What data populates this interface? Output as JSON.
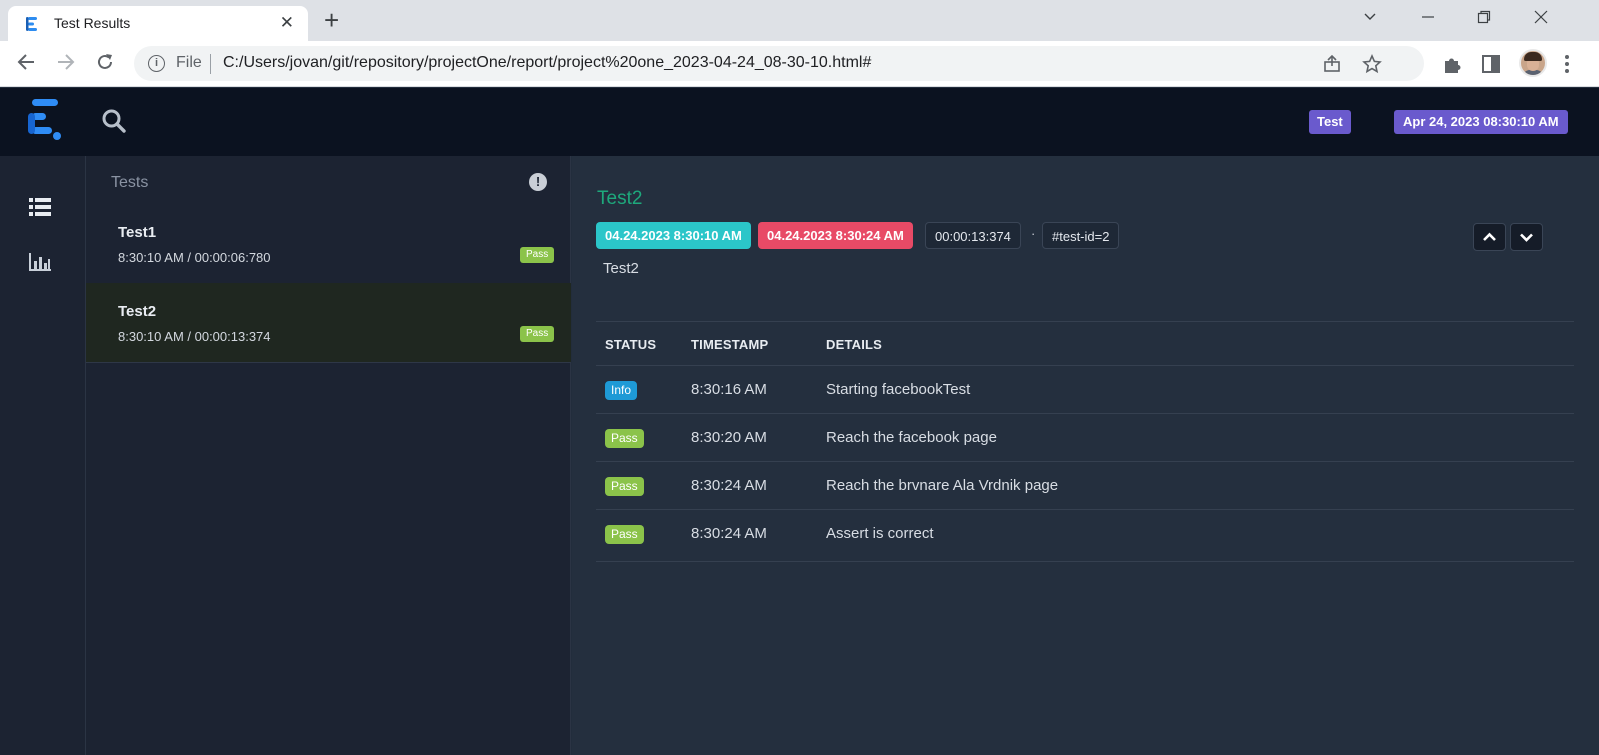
{
  "browser": {
    "tab_title": "Test Results",
    "tab_close": "✕",
    "new_tab": "+",
    "address_prefix": "File",
    "url": "C:/Users/jovan/git/repository/projectOne/report/project%20one_2023-04-24_08-30-10.html#"
  },
  "header": {
    "tag_badge": "Test",
    "date_badge": "Apr 24, 2023 08:30:10 AM"
  },
  "test_list": {
    "title": "Tests",
    "items": [
      {
        "name": "Test1",
        "meta": "8:30:10 AM / 00:00:06:780",
        "status": "Pass"
      },
      {
        "name": "Test2",
        "meta": "8:30:10 AM / 00:00:13:374",
        "status": "Pass"
      }
    ]
  },
  "detail": {
    "title": "Test2",
    "start_time": "04.24.2023 8:30:10 AM",
    "end_time": "04.24.2023 8:30:24 AM",
    "duration": "00:00:13:374",
    "separator": "·",
    "test_id": "#test-id=2",
    "description": "Test2",
    "columns": {
      "status": "STATUS",
      "timestamp": "TIMESTAMP",
      "details": "DETAILS"
    },
    "logs": [
      {
        "status": "Info",
        "timestamp": "8:30:16 AM",
        "details": "Starting facebookTest"
      },
      {
        "status": "Pass",
        "timestamp": "8:30:20 AM",
        "details": "Reach the facebook page"
      },
      {
        "status": "Pass",
        "timestamp": "8:30:24 AM",
        "details": "Reach the brvnare Ala Vrdnik page"
      },
      {
        "status": "Pass",
        "timestamp": "8:30:24 AM",
        "details": "Assert is correct"
      }
    ]
  },
  "colors": {
    "pass": "#8bc34a",
    "info": "#1e9ad6",
    "start_chip": "#2bc6c9",
    "end_chip": "#e84a66",
    "badge": "#6a5acd",
    "title_green": "#1ea97c"
  }
}
